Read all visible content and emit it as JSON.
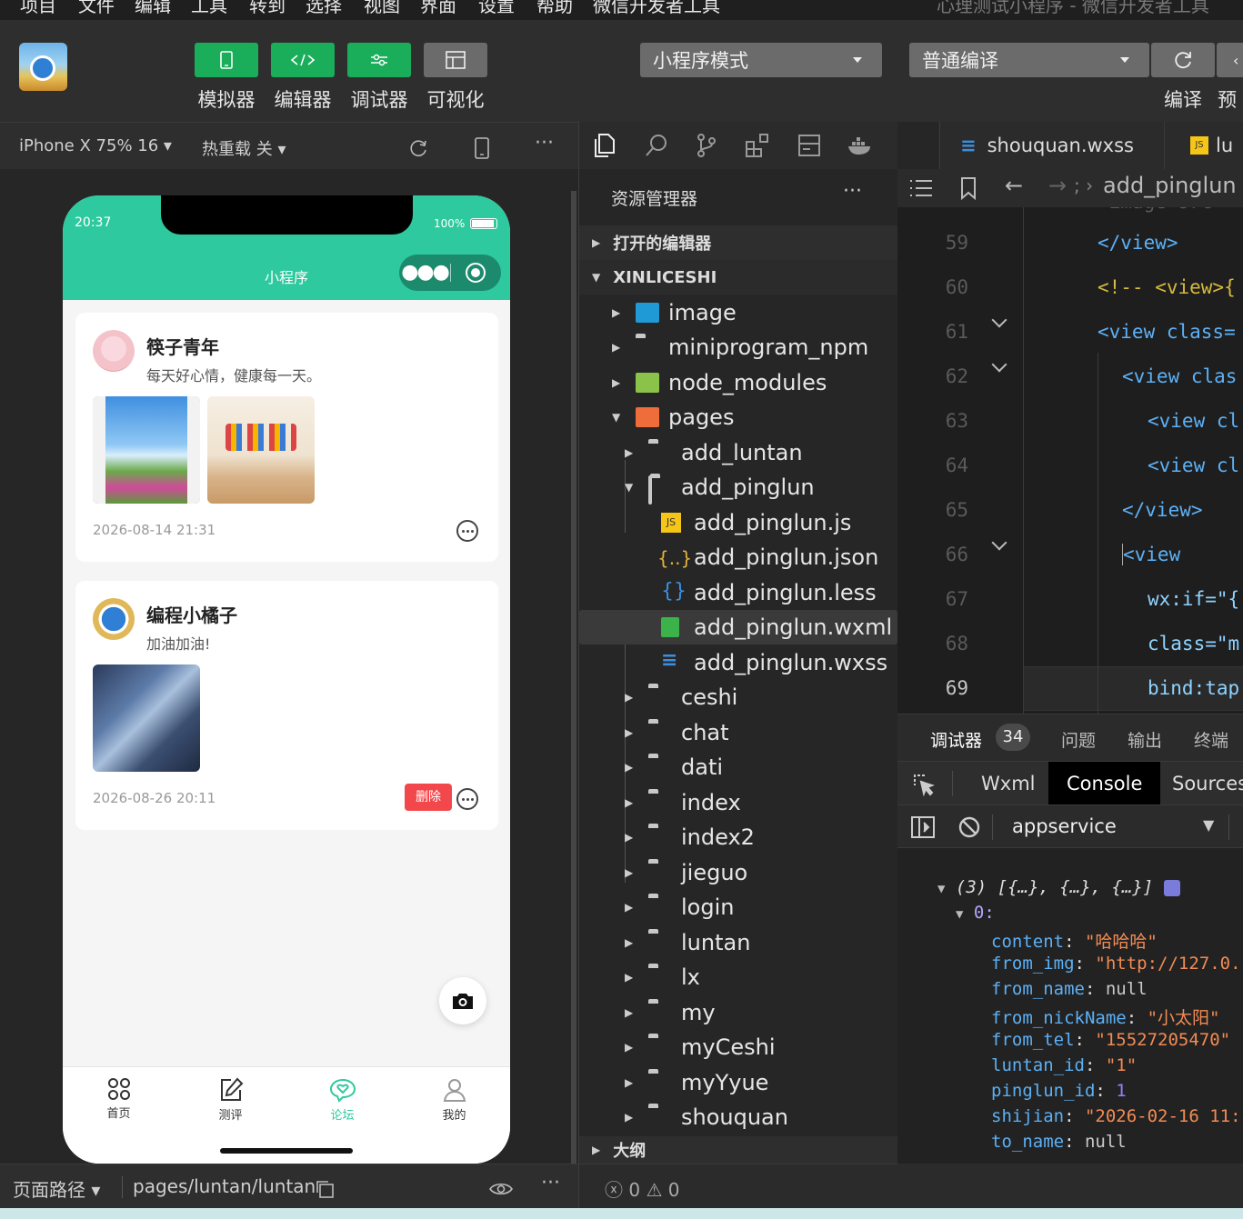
{
  "menubar": {
    "items": [
      "项目",
      "文件",
      "编辑",
      "工具",
      "转到",
      "选择",
      "视图",
      "界面",
      "设置",
      "帮助",
      "微信开发者工具"
    ],
    "window_title": "心理测试小程序 - 微信开发者工具"
  },
  "toolbar": {
    "buttons": [
      {
        "label": "模拟器",
        "icon": "phone-icon"
      },
      {
        "label": "编辑器",
        "icon": "code-icon"
      },
      {
        "label": "调试器",
        "icon": "debug-icon"
      },
      {
        "label": "可视化",
        "icon": "layout-icon"
      }
    ],
    "mode_select": "小程序模式",
    "compile_select": "普通编译",
    "compile_label": "编译",
    "preview_label": "预"
  },
  "simulator": {
    "device": "iPhone X 75% 16",
    "hotreload": "热重载 关",
    "status_time": "20:37",
    "battery": "100%",
    "nav_title": "小程序",
    "posts": [
      {
        "name": "筷子青年",
        "text": "每天好心情，健康每一天。",
        "time": "2026-08-14 21:31"
      },
      {
        "name": "编程小橘子",
        "text": "加油加油!",
        "time": "2026-08-26 20:11",
        "delete_label": "删除"
      }
    ],
    "tabs": [
      {
        "label": "首页",
        "icon": "grid-icon"
      },
      {
        "label": "测评",
        "icon": "edit-icon"
      },
      {
        "label": "论坛",
        "icon": "chat-heart-icon",
        "active": true
      },
      {
        "label": "我的",
        "icon": "user-icon"
      }
    ],
    "path_label": "页面路径",
    "path": "pages/luntan/luntan"
  },
  "explorer": {
    "title": "资源管理器",
    "open_editors": "打开的编辑器",
    "project": "XINLICESHI",
    "tree": [
      "image",
      "miniprogram_npm",
      "node_modules",
      "pages",
      "add_luntan",
      "add_pinglun",
      "add_pinglun.js",
      "add_pinglun.json",
      "add_pinglun.less",
      "add_pinglun.wxml",
      "add_pinglun.wxss",
      "ceshi",
      "chat",
      "dati",
      "index",
      "index2",
      "jieguo",
      "login",
      "luntan",
      "lx",
      "my",
      "myCeshi",
      "myYyue",
      "shouquan"
    ],
    "outline": "大纲",
    "errors": "0",
    "warnings": "0"
  },
  "editor": {
    "tabs": [
      "shouquan.wxss",
      "lu"
    ],
    "breadcrumb": "add_pinglun",
    "line_numbers": [
      "59",
      "60",
      "61",
      "62",
      "63",
      "64",
      "65",
      "66",
      "67",
      "68",
      "69"
    ],
    "lines": [
      "</view>",
      "<!-- <view>{",
      "<view class=",
      "<view clas",
      "<view cl",
      "<view cl",
      "</view>",
      "<view",
      "wx:if=\"{",
      "class=\"m",
      "bind:tap"
    ]
  },
  "debugger": {
    "tabs": [
      "调试器",
      "问题",
      "输出",
      "终端"
    ],
    "badge": "34",
    "panel_tabs": [
      "Wxml",
      "Console",
      "Sources"
    ],
    "context": "appservice",
    "console": {
      "summary": "(3) [{…}, {…}, {…}]",
      "index": "0:",
      "fields": [
        {
          "k": "content",
          "v": "\"哈哈哈\"",
          "t": "s"
        },
        {
          "k": "from_img",
          "v": "\"http://127.0.",
          "t": "s"
        },
        {
          "k": "from_name",
          "v": "null",
          "t": "nl"
        },
        {
          "k": "from_nickName",
          "v": "\"小太阳\"",
          "t": "s"
        },
        {
          "k": "from_tel",
          "v": "\"15527205470\"",
          "t": "s"
        },
        {
          "k": "luntan_id",
          "v": "\"1\"",
          "t": "s"
        },
        {
          "k": "pinglun_id",
          "v": "1",
          "t": "n"
        },
        {
          "k": "shijian",
          "v": "\"2026-02-16 11:",
          "t": "s"
        },
        {
          "k": "to_name",
          "v": "null",
          "t": "nl"
        }
      ]
    }
  },
  "colors": {
    "accent": "#2ec99e",
    "toolbar_green": "#1aad5a",
    "delete_red": "#f2484c"
  }
}
